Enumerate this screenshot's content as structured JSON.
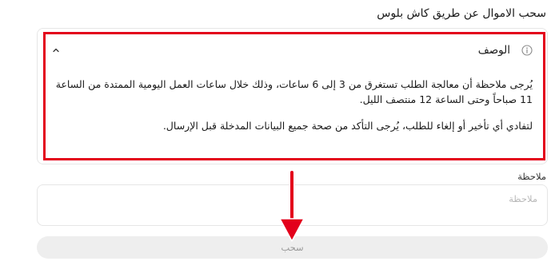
{
  "page": {
    "title": "سحب الاموال عن طريق كاش بلوس"
  },
  "description": {
    "title": "الوصف",
    "paragraphs": [
      "يُرجى ملاحظة أن معالجة الطلب تستغرق من 3 إلى 6 ساعات، وذلك خلال ساعات العمل اليومية الممتدة من الساعة 11 صباحاً وحتى الساعة 12 منتصف الليل.",
      "لتفادي أي تأخير أو إلغاء للطلب، يُرجى التأكد من صحة جميع البيانات المدخلة قبل الإرسال."
    ],
    "icons": {
      "info": "info-icon",
      "collapse": "chevron-up-icon"
    }
  },
  "note": {
    "label": "ملاحظة",
    "placeholder": "ملاحظة",
    "value": ""
  },
  "submit": {
    "label": "سحب"
  },
  "colors": {
    "annotation_red": "#e3001b",
    "border": "#e6e6e6",
    "button_bg": "#eeeeee",
    "button_text": "#9a9a9a"
  }
}
